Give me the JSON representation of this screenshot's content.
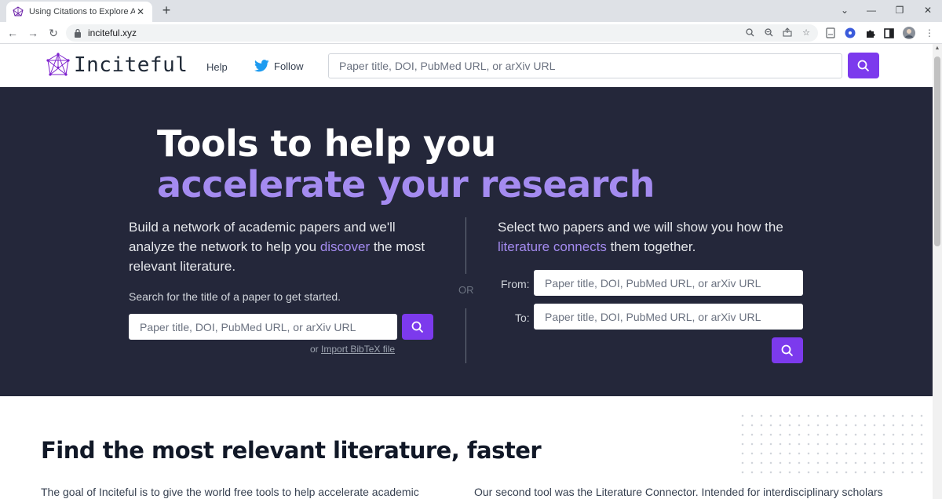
{
  "browser": {
    "tab_title": "Using Citations to Explore Acade",
    "tab_close": "✕",
    "new_tab": "+",
    "url": "inciteful.xyz",
    "back": "←",
    "forward": "→",
    "reload": "↻",
    "window_controls": {
      "minimize": "—",
      "restore": "❐",
      "close": "✕"
    }
  },
  "header": {
    "logo_text": "Inciteful",
    "help_label": "Help",
    "follow_label": "Follow",
    "search_placeholder": "Paper title, DOI, PubMed URL, or arXiv URL"
  },
  "hero": {
    "title_line1": "Tools to help you",
    "title_line2": "accelerate your research",
    "left_desc_part1": "Build a network of academic papers and we'll analyze the network to help you ",
    "left_desc_accent": "discover",
    "left_desc_part2": " the most relevant literature.",
    "search_hint": "Search for the title of a paper to get started.",
    "search_placeholder": "Paper title, DOI, PubMed URL, or arXiv URL",
    "import_prefix": "or ",
    "import_link": "Import BibTeX file",
    "or_label": "OR",
    "right_desc_part1": "Select two papers and we will show you how the ",
    "right_desc_accent": "literature connects",
    "right_desc_part2": " them together.",
    "from_label": "From:",
    "to_label": "To:",
    "from_placeholder": "Paper title, DOI, PubMed URL, or arXiv URL",
    "to_placeholder": "Paper title, DOI, PubMed URL, or arXiv URL"
  },
  "section": {
    "title": "Find the most relevant literature, faster",
    "left_para": "The goal of Inciteful is to give the world free tools to help accelerate academic",
    "right_para": "Our second tool was the Literature Connector. Intended for interdisciplinary scholars"
  },
  "colors": {
    "accent": "#7c3aed",
    "accent_text": "#a48bf0",
    "hero_bg": "#24273a",
    "twitter": "#1d9bf0"
  }
}
